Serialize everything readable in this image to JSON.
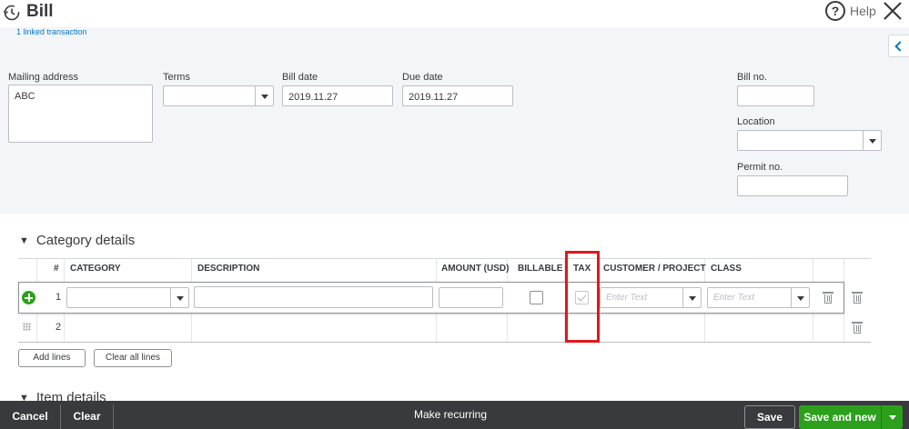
{
  "header": {
    "title": "Bill",
    "help_label": "Help"
  },
  "form": {
    "linked_transaction": "1 linked transaction",
    "mailing_address": {
      "label": "Mailing address",
      "value": "ABC"
    },
    "terms": {
      "label": "Terms",
      "value": ""
    },
    "bill_date": {
      "label": "Bill date",
      "value": "2019.11.27"
    },
    "due_date": {
      "label": "Due date",
      "value": "2019.11.27"
    },
    "bill_no": {
      "label": "Bill no.",
      "value": ""
    },
    "location": {
      "label": "Location",
      "value": ""
    },
    "permit_no": {
      "label": "Permit no.",
      "value": ""
    }
  },
  "category_details": {
    "title": "Category details",
    "columns": [
      "#",
      "CATEGORY",
      "DESCRIPTION",
      "AMOUNT (USD)",
      "BILLABLE",
      "TAX",
      "CUSTOMER / PROJECT",
      "CLASS"
    ],
    "rows": [
      {
        "num": "1",
        "billable": false,
        "tax": true,
        "customer_placeholder": "Enter Text",
        "class_placeholder": "Enter Text"
      },
      {
        "num": "2"
      }
    ],
    "add_lines": "Add lines",
    "clear_all_lines": "Clear all lines"
  },
  "item_details": {
    "title": "Item details"
  },
  "footer": {
    "cancel": "Cancel",
    "clear": "Clear",
    "make_recurring": "Make recurring",
    "save": "Save",
    "save_and_new": "Save and new"
  },
  "colors": {
    "accent_green": "#2ca01c",
    "link_blue": "#0077c5",
    "highlight_red": "#e2161c",
    "footer_bg": "#393a3d"
  },
  "icons": [
    "history-icon",
    "help-icon",
    "close-icon",
    "collapse-panel-icon",
    "add-line-icon",
    "drag-handle-icon",
    "trash-icon",
    "chevron-down-icon"
  ]
}
